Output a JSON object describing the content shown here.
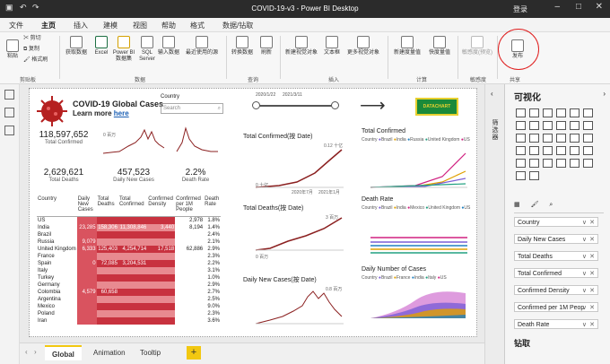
{
  "window": {
    "title": "COVID-19-v3 - Power BI Desktop",
    "signin": "登录"
  },
  "tabs": [
    "文件",
    "主页",
    "插入",
    "建模",
    "视图",
    "帮助",
    "格式",
    "数据/钻取"
  ],
  "ribbon": {
    "buttons": [
      {
        "label": "粘贴"
      },
      {
        "label": "剪切"
      },
      {
        "label": "复制"
      },
      {
        "label": "格式刷"
      },
      {
        "label": "获取数据"
      },
      {
        "label": "Excel"
      },
      {
        "label": "Power BI 数据集"
      },
      {
        "label": "SQL Server"
      },
      {
        "label": "输入数据"
      },
      {
        "label": "最近使用的源"
      },
      {
        "label": "转换数据"
      },
      {
        "label": "刷新"
      },
      {
        "label": "新建视觉对象"
      },
      {
        "label": "文本框"
      },
      {
        "label": "更多视觉对象"
      },
      {
        "label": "新建度量值"
      },
      {
        "label": "快度量值"
      },
      {
        "label": "敏感度(预览)"
      },
      {
        "label": "发布"
      }
    ],
    "groups": [
      "剪贴板",
      "数据",
      "查询",
      "插入",
      "计算",
      "敏感度",
      "共享"
    ]
  },
  "report": {
    "header_title": "COVID-19 Global Cases",
    "header_sub": "Learn more here",
    "header_link": "here",
    "country_label": "Country",
    "search_placeholder": "Search",
    "date_start": "2020/1/22",
    "date_end": "2021/3/11",
    "logo_text": "DATACHART",
    "cards": [
      {
        "value": "118,597,652",
        "label": "Total Confirmed"
      },
      {
        "value": "2,629,621",
        "label": "Total Deaths"
      },
      {
        "value": "457,523",
        "label": "Daily New Cases"
      },
      {
        "value": "2.2%",
        "label": "Death Rate"
      }
    ],
    "spark_label": "0 百万",
    "charts": [
      {
        "title": "Total Confirmed(按 Date)"
      },
      {
        "title": "Total Deaths(按 Date)"
      },
      {
        "title": "Daily New Cases(按 Date)"
      },
      {
        "title": "Total Confirmed"
      },
      {
        "title": "Death Rate"
      },
      {
        "title": "Daily Number of Cases"
      }
    ],
    "legend_country": "Country",
    "legend_items1": [
      "Brazil",
      "India",
      "Russia",
      "United Kingdom",
      "US"
    ],
    "legend_items2": [
      "Brazil",
      "India",
      "Mexico",
      "United Kingdom",
      "US"
    ],
    "legend_items3": [
      "Brazil",
      "France",
      "India",
      "Italy",
      "US"
    ],
    "axis": {
      "x1": "2020年7月",
      "x2": "2021年1月",
      "y_tc": "0.12 十亿",
      "y_tc2": "0.1 十亿",
      "y_td": "3 百万",
      "y_dn": "0.8 百万",
      "zero_b": "0 十亿",
      "zero_m": "0 百万"
    },
    "table": {
      "headers": [
        "Country",
        "Daily New Cases",
        "Total Deaths",
        "Total Confirmed",
        "Confirmed Density",
        "Confirmed per 1M People",
        "Death Rate"
      ],
      "rows": [
        [
          "US",
          "",
          "",
          "",
          "",
          "2,978",
          "1.8%"
        ],
        [
          "India",
          "23,285",
          "158,306",
          "11,308,846",
          "3,440",
          "8,194",
          "1.4%"
        ],
        [
          "Brazil",
          "",
          "",
          "",
          "",
          "",
          "2.4%"
        ],
        [
          "Russia",
          "9,079",
          "",
          "",
          "",
          "",
          "2.1%"
        ],
        [
          "United Kingdom",
          "6,333",
          "125,403",
          "4,254,714",
          "17,518",
          "62,886",
          "2.9%"
        ],
        [
          "France",
          "",
          "",
          "",
          "",
          "",
          "2.3%"
        ],
        [
          "Spain",
          "0",
          "72,085",
          "3,204,531",
          "",
          "",
          "2.2%"
        ],
        [
          "Italy",
          "",
          "",
          "",
          "",
          "",
          "3.1%"
        ],
        [
          "Turkey",
          "",
          "",
          "",
          "",
          "",
          "1.0%"
        ],
        [
          "Germany",
          "",
          "",
          "",
          "",
          "",
          "2.9%"
        ],
        [
          "Colombia",
          "4,579",
          "60,658",
          "",
          "",
          "",
          "2.7%"
        ],
        [
          "Argentina",
          "",
          "",
          "",
          "",
          "",
          "2.5%"
        ],
        [
          "Mexico",
          "",
          "",
          "",
          "",
          "",
          "9.0%"
        ],
        [
          "Poland",
          "",
          "",
          "",
          "",
          "",
          "2.3%"
        ],
        [
          "Iran",
          "",
          "",
          "",
          "",
          "",
          "3.6%"
        ]
      ]
    }
  },
  "pages": [
    "Global",
    "Animation",
    "Tooltip",
    "+"
  ],
  "rightpanel": {
    "filters_label": "筛选器",
    "title": "可视化",
    "fields": [
      "Country",
      "Daily New Cases",
      "Total Deaths",
      "Total Confirmed",
      "Confirmed Density",
      "Confirmed per 1M Peop",
      "Death Rate"
    ],
    "drill": "钻取"
  }
}
